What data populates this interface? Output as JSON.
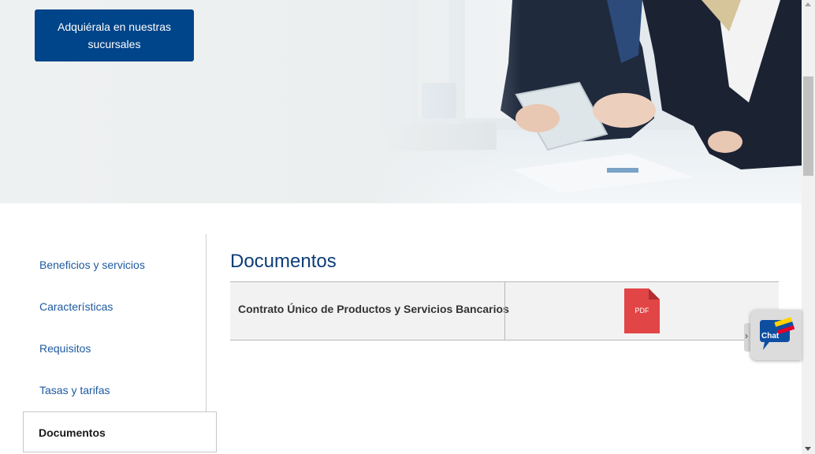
{
  "hero": {
    "cta_label": "Adquiérala en nuestras sucursales"
  },
  "sidenav": {
    "items": [
      {
        "label": "Beneficios y servicios"
      },
      {
        "label": "Características"
      },
      {
        "label": "Requisitos"
      },
      {
        "label": "Tasas y tarifas"
      },
      {
        "label": "Documentos",
        "active": true
      }
    ]
  },
  "documents": {
    "title": "Documentos",
    "rows": [
      {
        "name": "Contrato Único de Productos y Servicios Bancarios",
        "file_type": "PDF"
      }
    ]
  },
  "chat": {
    "label": "Chat",
    "tab_glyph": "›"
  },
  "colors": {
    "brand_blue": "#004489",
    "link_blue": "#1e5aa0",
    "title_blue": "#0d3c78",
    "pdf_red": "#e24545"
  },
  "icons": [
    "pdf-icon",
    "chat-icon",
    "chevron-right-icon"
  ]
}
